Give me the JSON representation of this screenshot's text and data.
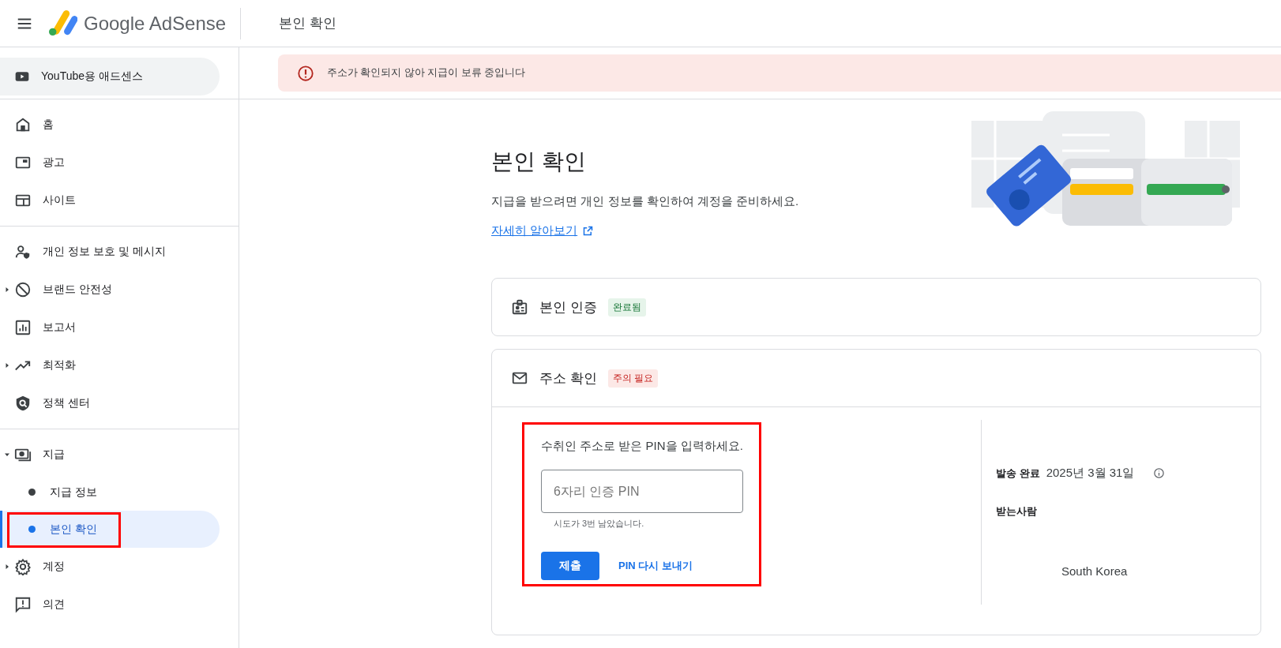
{
  "header": {
    "product": "Google AdSense",
    "page_title": "본인 확인"
  },
  "sidebar": {
    "youtube_item": "YouTube용 애드센스",
    "sections": [
      [
        {
          "label": "홈"
        },
        {
          "label": "광고"
        },
        {
          "label": "사이트"
        }
      ],
      [
        {
          "label": "개인 정보 보호 및 메시지"
        },
        {
          "label": "브랜드 안전성",
          "expanded": false
        },
        {
          "label": "보고서"
        },
        {
          "label": "최적화",
          "expanded": false
        },
        {
          "label": "정책 센터"
        }
      ],
      [
        {
          "label": "지급",
          "expanded": true,
          "children": [
            {
              "label": "지급 정보",
              "selected": false,
              "highlighted": false
            },
            {
              "label": "본인 확인",
              "selected": true,
              "highlighted": true
            }
          ]
        },
        {
          "label": "계정",
          "expanded": false
        },
        {
          "label": "의견"
        }
      ]
    ]
  },
  "alert": {
    "text": "주소가 확인되지 않아 지급이 보류 중입니다"
  },
  "intro": {
    "title": "본인 확인",
    "description": "지급을 받으려면 개인 정보를 확인하여 계정을 준비하세요.",
    "link": "자세히 알아보기"
  },
  "steps": [
    {
      "title": "본인 인증",
      "badge": "완료됨",
      "kind": "done",
      "expanded": false
    },
    {
      "title": "주소 확인",
      "badge": "주의 필요",
      "kind": "attention",
      "expanded": true
    }
  ],
  "pin_form": {
    "highlighted": true,
    "instruction": "수취인 주소로 받은 PIN을 입력하세요.",
    "placeholder": "6자리 인증 PIN",
    "hint": "시도가 3번 남았습니다.",
    "submit": "제출",
    "resend": "PIN 다시 보내기"
  },
  "mailing": {
    "sent_label": "발송 완료",
    "sent_date": "2025년 3월 31일",
    "recipient_label": "받는사람",
    "country": "South Korea"
  }
}
